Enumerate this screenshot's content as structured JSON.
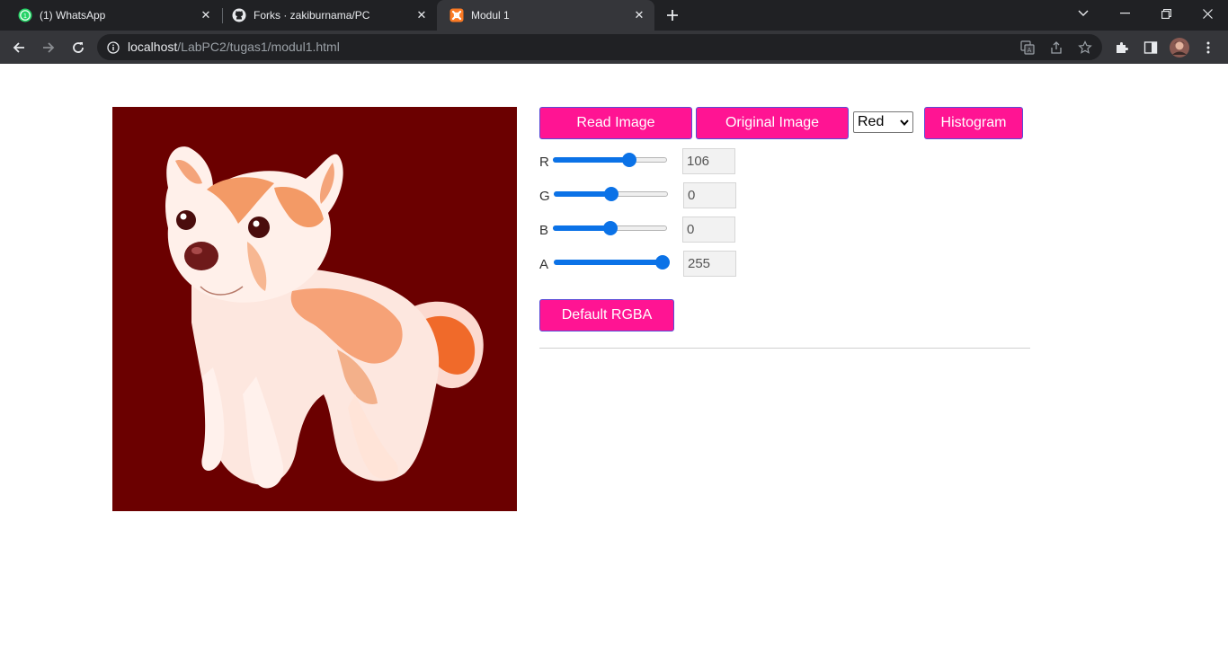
{
  "browser": {
    "tabs": [
      {
        "title": "(1) WhatsApp",
        "icon": "whatsapp-icon",
        "active": false
      },
      {
        "title": "Forks · zakiburnama/PC",
        "icon": "github-icon",
        "active": false
      },
      {
        "title": "Modul 1",
        "icon": "xampp-icon",
        "active": true
      }
    ],
    "url": {
      "host": "localhost",
      "path": "/LabPC2/tugas1/modul1.html"
    }
  },
  "page": {
    "buttons": {
      "read_image": "Read Image",
      "original_image": "Original Image",
      "histogram": "Histogram",
      "default_rgba": "Default RGBA"
    },
    "channel_select": {
      "value": "Red"
    },
    "sliders": [
      {
        "label": "R",
        "value": "106",
        "level": 0.69
      },
      {
        "label": "G",
        "value": "0",
        "level": 0.5
      },
      {
        "label": "B",
        "value": "0",
        "level": 0.5
      },
      {
        "label": "A",
        "value": "255",
        "level": 1.0
      }
    ]
  },
  "colors": {
    "button_bg": "#ff1493",
    "slider_accent": "#0b72e7",
    "image_background": "#6b0000"
  }
}
